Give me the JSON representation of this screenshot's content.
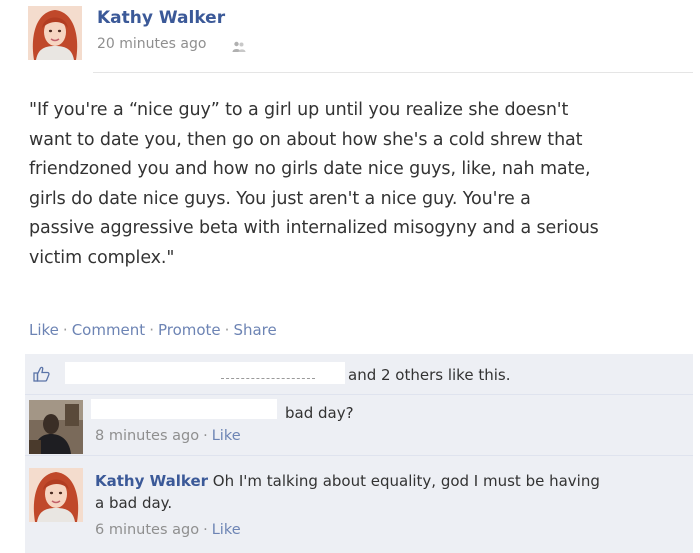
{
  "post": {
    "author": "Kathy Walker",
    "timestamp": "20 minutes ago",
    "audience_icon": "friends-icon",
    "body_lines": [
      "\"If you're a “nice guy” to a girl up until you realize she doesn't",
      "want to date you, then go on about how she's a cold shrew that",
      "friendzoned you and how no girls date nice guys, like, nah mate,",
      "girls do date nice guys. You just aren't a nice guy. You're a",
      "passive aggressive beta with internalized misogyny and a serious",
      "victim complex.\""
    ]
  },
  "actions": {
    "like": "Like",
    "comment": "Comment",
    "promote": "Promote",
    "share": "Share",
    "separator": "·"
  },
  "likes": {
    "icon": "thumbs-up-icon",
    "text": "and 2 others like this."
  },
  "comments": [
    {
      "author": "",
      "text": "bad day?",
      "time": "8 minutes ago",
      "like": "Like"
    },
    {
      "author": "Kathy Walker",
      "text_line1": "Oh I'm talking about equality, god I must be having",
      "text_line2": "a bad day.",
      "time": "6 minutes ago",
      "like": "Like"
    }
  ],
  "colors": {
    "link": "#3b5998",
    "action_link": "#6d84b4",
    "feedback_bg": "#edeff4"
  }
}
